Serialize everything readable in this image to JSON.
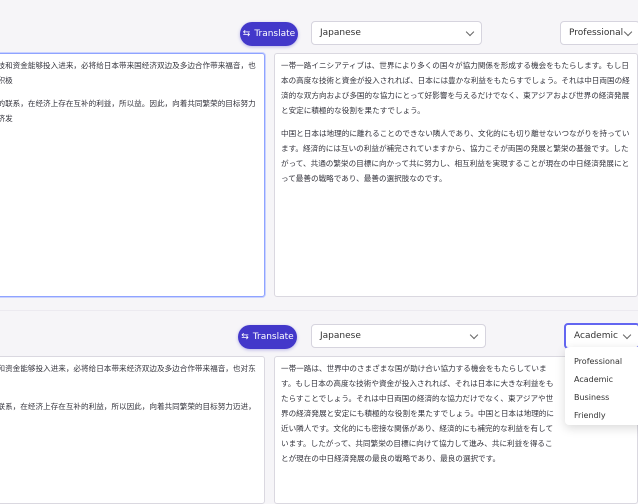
{
  "top": {
    "translate_label": "Translate",
    "language_value": "Japanese",
    "tone_value": "Professional",
    "source_paragraphs": [
      "形成互助合作的契机。如果日本高科技和资金能够投入进来，必将给日本带来国经济双边及多边合作带来福音，也对东亚及世界的经济发展和稳定发挥积极",
      "走的邻国，在文化上有着切也切不断的联系，在经济上存在互补的利益，所以益。因此，向着共同繁荣的目标努力迈进，实现共赢，这才是当今中日经济发"
    ],
    "output_paragraphs": [
      "一帯一路イニシアティブは、世界により多くの国々が協力関係を形成する機会をもたらします。もし日本の高度な技術と資金が投入されれば、日本には豊かな利益をもたらすでしょう。それは中日両国の経済的な双方向および多国的な協力にとって好影響を与えるだけでなく、東アジアおよび世界の経済発展と安定に積極的な役割を果たすでしょう。",
      "中国と日本は地理的に離れることのできない隣人であり、文化的にも切り離せないつながりを持っています。経済的には互いの利益が補完されていますから、協力こそが両国の発展と繁栄の基盤です。したがって、共通の繁栄の目標に向かって共に努力し、相互利益を実現することが現在の中日経済発展にとって最善の戦略であり、最善の選択肢なのです。"
    ]
  },
  "bottom": {
    "translate_label": "Translate",
    "language_value": "Japanese",
    "tone_value": "Academic",
    "source_paragraphs": [
      "成互助合作的契机。如果日本高科技和资金能够投入进来，必将给日本带来经济双边及多边合作带来福音，也对东亚及世界的经济发展和稳定发挥积极",
      "的邻国，在文化上有着切也切不断的联系，在经济上存在互补的利益，所以因此，向着共同繁荣的目标努力迈进，实现共赢，这才是当今中日经济发"
    ],
    "output_paragraphs": [
      "一帯一路は、世界中のさまざまな国が助け合い協力する機会をもたらしています。もし日本の高度な技術や資金が投入されれば、それは日本に大きな利益をもたらすことでしょう。それは中日両国の経済的な協力だけでなく、東アジアや世界の経済発展と安定にも積極的な役割を果たすでしょう。中国と日本は地理的に近い隣人です。文化的にも密接な関係があり、経済的にも補完的な利益を有しています。したがって、共同繁栄の目標に向けて協力して進み、共に利益を得ることが現在の中日経済発展の最良の戦略であり、最良の選択です。"
    ],
    "tone_options": [
      "Professional",
      "Academic",
      "Business",
      "Friendly"
    ]
  }
}
